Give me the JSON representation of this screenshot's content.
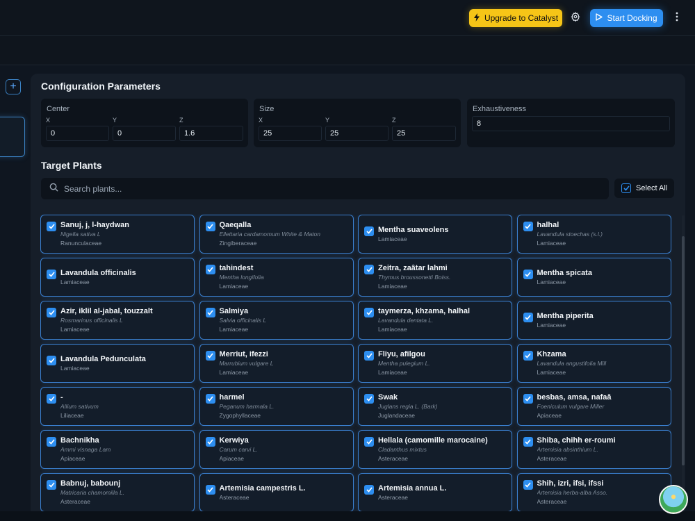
{
  "header": {
    "upgrade_label": "Upgrade to Catalyst",
    "start_label": "Start Docking"
  },
  "config": {
    "title": "Configuration Parameters",
    "center": {
      "label": "Center",
      "x_axis": "X",
      "y_axis": "Y",
      "z_axis": "Z",
      "x": "0",
      "y": "0",
      "z": "1.6"
    },
    "size": {
      "label": "Size",
      "x_axis": "X",
      "y_axis": "Y",
      "z_axis": "Z",
      "x": "25",
      "y": "25",
      "z": "25"
    },
    "exhaustiveness": {
      "label": "Exhaustiveness",
      "value": "8"
    }
  },
  "plants": {
    "title": "Target Plants",
    "search_placeholder": "Search plants...",
    "select_all_label": "Select All",
    "items": [
      {
        "name": "Sanuj, j, l-haydwan",
        "sci": "Nigella sativa L",
        "family": "Ranunculaceae"
      },
      {
        "name": "Qaeqalla",
        "sci": "Ellettaria cardamomum White & Maton",
        "family": "Zingiberaceae"
      },
      {
        "name": "Mentha suaveolens",
        "sci": "",
        "family": "Lamiaceae"
      },
      {
        "name": "halhal",
        "sci": "Lavandula stoechas (s.l.)",
        "family": "Lamiaceae"
      },
      {
        "name": "Lavandula officinalis",
        "sci": "",
        "family": "Lamiaceae"
      },
      {
        "name": "tahindest",
        "sci": "Mentha longifolia",
        "family": "Lamiaceae"
      },
      {
        "name": "Zeitra, zaâtar lahmi",
        "sci": "Thymus broussonetti Boiss.",
        "family": "Lamiaceae"
      },
      {
        "name": "Mentha spicata",
        "sci": "",
        "family": "Lamiaceae"
      },
      {
        "name": "Azir, iklil al-jabal, touzzalt",
        "sci": "Rosmarinus officinalis L",
        "family": "Lamiaceae"
      },
      {
        "name": "Salmiya",
        "sci": "Salvia officinalis L",
        "family": "Lamiaceae"
      },
      {
        "name": "taymerza, khzama, halhal",
        "sci": "Lavandula dentata L.",
        "family": "Lamiaceae"
      },
      {
        "name": "Mentha piperita",
        "sci": "",
        "family": "Lamiaceae"
      },
      {
        "name": "Lavandula Pedunculata",
        "sci": "",
        "family": "Lamiaceae"
      },
      {
        "name": "Merriut, ifezzi",
        "sci": "Marrubium vulgare L",
        "family": "Lamiaceae"
      },
      {
        "name": "Fliyu, afilgou",
        "sci": "Mentha pulegium L.",
        "family": "Lamiaceae"
      },
      {
        "name": "Khzama",
        "sci": "Lavandula angustifolia Mill",
        "family": "Lamiaceae"
      },
      {
        "name": "-",
        "sci": "Allium sativum",
        "family": "Liliaceae"
      },
      {
        "name": "harmel",
        "sci": "Peganum harmala L.",
        "family": "Zygophyllaceae"
      },
      {
        "name": "Swak",
        "sci": "Juglans regia L. (Bark)",
        "family": "Juglandaceae"
      },
      {
        "name": "besbas, amsa, nafaâ",
        "sci": "Foeniculum vulgare Miller",
        "family": "Apiaceae"
      },
      {
        "name": "Bachnikha",
        "sci": "Ammi visnaga Lam",
        "family": "Apiaceae"
      },
      {
        "name": "Kerwiya",
        "sci": "Carum carvi L.",
        "family": "Apiaceae"
      },
      {
        "name": "Hellala (camomille marocaine)",
        "sci": "Cladanthus mixtus",
        "family": "Asteraceae"
      },
      {
        "name": "Shiba, chihh er-roumi",
        "sci": "Artemisia absinthium L.",
        "family": "Asteraceae"
      },
      {
        "name": "Babnuj, babounj",
        "sci": "Matricaria chamomilla L.",
        "family": "Asteraceae"
      },
      {
        "name": "Artemisia campestris L.",
        "sci": "",
        "family": "Asteraceae"
      },
      {
        "name": "Artemisia annua L.",
        "sci": "",
        "family": "Asteraceae"
      },
      {
        "name": "Shih, izri, ifsi, ifssi",
        "sci": "Artemisia herba-alba Asso.",
        "family": "Asteraceae"
      }
    ]
  },
  "colors": {
    "accent": "#2d8ef0",
    "upgrade": "#f6c517",
    "panel": "#161e29"
  }
}
